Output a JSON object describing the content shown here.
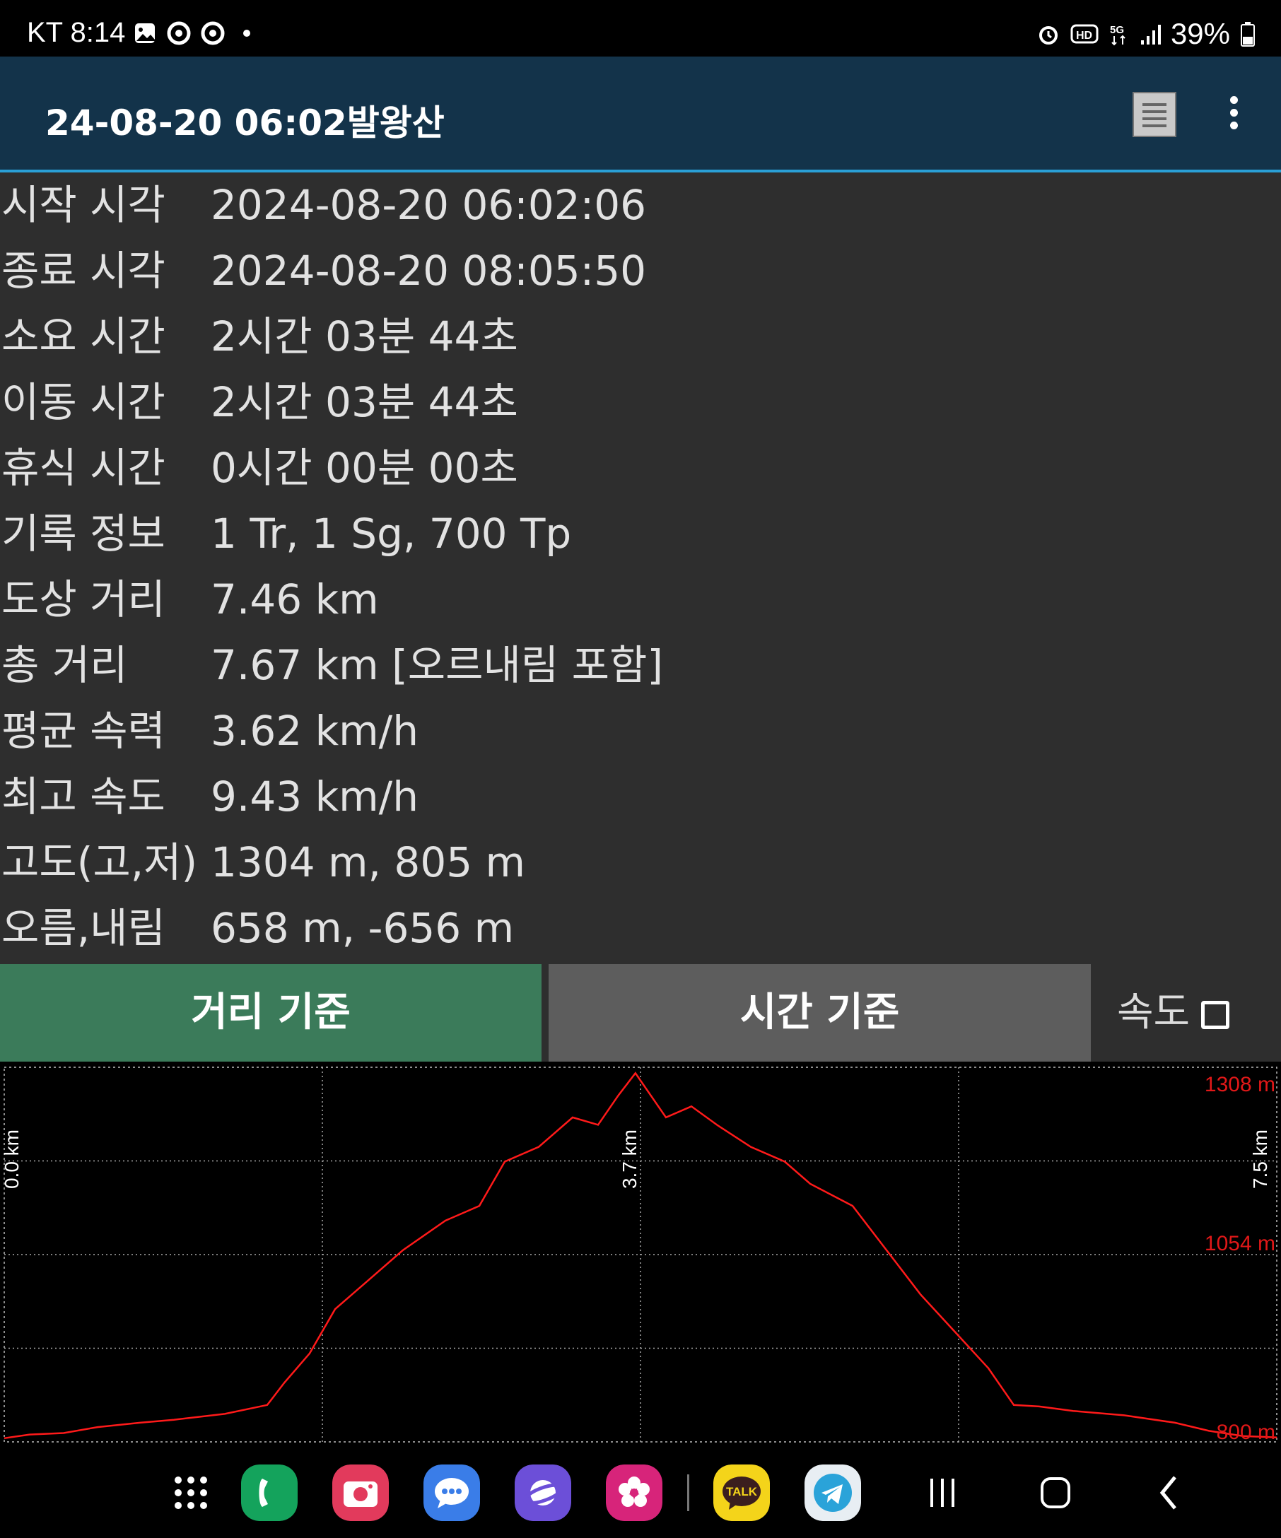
{
  "status_bar": {
    "carrier": "KT",
    "time": "8:14",
    "battery": "39%",
    "left_icons": [
      "gallery-icon",
      "chrome-icon",
      "chrome-icon",
      "dot-icon"
    ],
    "right_icons": [
      "alarm-icon",
      "hd-voice-icon",
      "5g-icon",
      "signal-icon",
      "battery-icon"
    ]
  },
  "app_bar": {
    "title": "24-08-20 06:02발왕산",
    "actions": [
      "list-icon",
      "more-vert-icon"
    ]
  },
  "stats": [
    {
      "label": "시작 시각",
      "value": "2024-08-20 06:02:06"
    },
    {
      "label": "종료 시각",
      "value": "2024-08-20 08:05:50"
    },
    {
      "label": "소요 시간",
      "value": "2시간 03분 44초"
    },
    {
      "label": "이동 시간",
      "value": "2시간 03분 44초"
    },
    {
      "label": "휴식 시간",
      "value": "0시간 00분 00초"
    },
    {
      "label": "기록 정보",
      "value": "1 Tr, 1 Sg, 700 Tp"
    },
    {
      "label": "도상 거리",
      "value": "7.46 km"
    },
    {
      "label": "총 거리",
      "value": "7.67 km [오르내림 포함]"
    },
    {
      "label": "평균 속력",
      "value": "3.62 km/h"
    },
    {
      "label": "최고 속도",
      "value": "9.43 km/h"
    },
    {
      "label": "고도(고,저)",
      "value": "1304 m, 805 m"
    },
    {
      "label": "오름,내림",
      "value": "658 m, -656 m"
    }
  ],
  "tabs": {
    "distance": "거리 기준",
    "time": "시간 기준",
    "speed_label": "속도",
    "speed_checked": false,
    "active": "distance"
  },
  "chart_data": {
    "type": "line",
    "x_unit": "km",
    "y_unit": "m",
    "x_tick_labels": [
      "0.0 km",
      "3.7 km",
      "7.5 km"
    ],
    "y_tick_labels": [
      "1308 m",
      "1054 m",
      "800 m"
    ],
    "ylim": [
      800,
      1308
    ],
    "xlim": [
      0,
      7.5
    ],
    "grid": true,
    "line_color": "#ff1a1a",
    "series": [
      {
        "x": [
          0,
          0.15,
          0.35,
          0.55,
          0.8,
          1.0,
          1.3,
          1.55,
          1.65,
          1.8,
          1.95,
          2.1,
          2.35,
          2.6,
          2.8,
          2.95,
          3.15,
          3.35,
          3.5,
          3.62,
          3.72,
          3.9,
          4.05,
          4.2,
          4.4,
          4.6,
          4.75,
          5.0,
          5.2,
          5.4,
          5.6,
          5.8,
          5.95,
          6.1,
          6.3,
          6.6,
          6.9,
          7.1,
          7.3,
          7.5
        ],
        "y": [
          805,
          810,
          812,
          820,
          826,
          830,
          838,
          850,
          880,
          920,
          980,
          1010,
          1060,
          1100,
          1120,
          1180,
          1200,
          1240,
          1230,
          1270,
          1300,
          1240,
          1255,
          1230,
          1200,
          1180,
          1150,
          1120,
          1060,
          1000,
          950,
          900,
          850,
          848,
          842,
          836,
          826,
          815,
          808,
          806
        ]
      }
    ]
  },
  "nav_bar": {
    "apps": [
      "apps-grid-icon",
      "phone-app-icon",
      "camera-app-icon",
      "messages-app-icon",
      "internet-app-icon",
      "gallery-app-icon",
      "kakaotalk-app-icon",
      "telegram-app-icon"
    ],
    "kakao_label": "TALK",
    "buttons": [
      "recents-button",
      "home-button",
      "back-button"
    ]
  }
}
